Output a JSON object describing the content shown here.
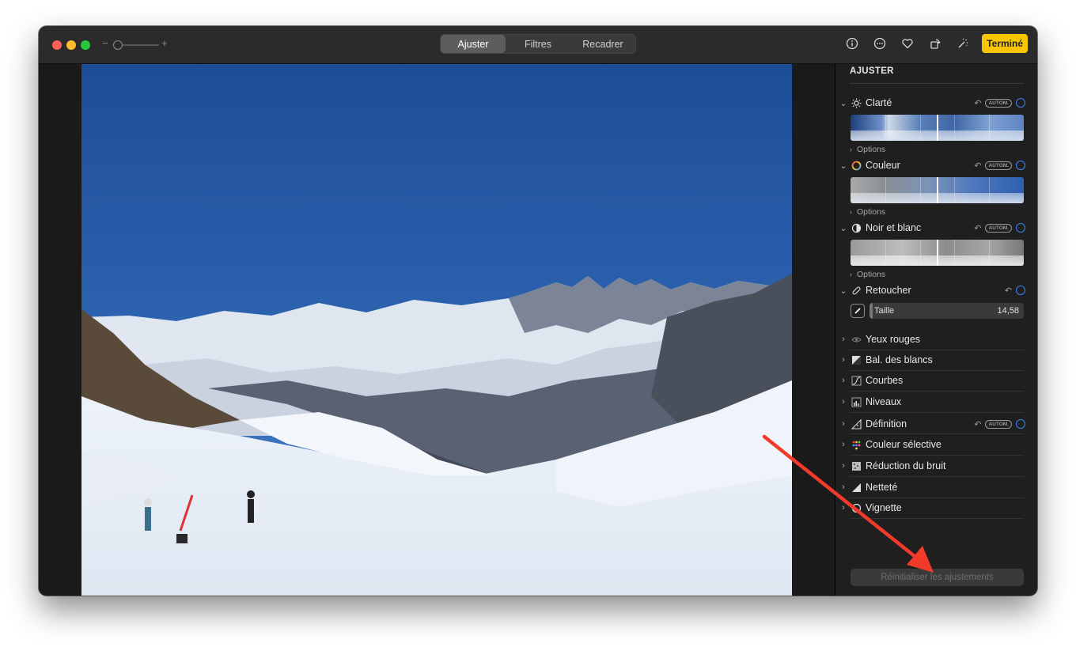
{
  "toolbar": {
    "zoom_minus": "−",
    "zoom_plus": "+",
    "tabs": [
      {
        "label": "Ajuster",
        "active": true
      },
      {
        "label": "Filtres",
        "active": false
      },
      {
        "label": "Recadrer",
        "active": false
      }
    ],
    "done_label": "Terminé",
    "icons": [
      "info-icon",
      "more-icon",
      "heart-icon",
      "rotate-icon",
      "magic-wand-icon"
    ]
  },
  "sidebar": {
    "title": "AJUSTER",
    "options_label": "Options",
    "sections": [
      {
        "label": "Clarté",
        "auto": "AUTOM.",
        "icon": "sun-icon",
        "expanded": true
      },
      {
        "label": "Couleur",
        "auto": "AUTOM.",
        "icon": "color-ring-icon",
        "expanded": true
      },
      {
        "label": "Noir et blanc",
        "auto": "AUTOM.",
        "icon": "half-circle-icon",
        "expanded": true
      },
      {
        "label": "Retoucher",
        "icon": "bandage-icon",
        "expanded": true
      }
    ],
    "retouch": {
      "size_label": "Taille",
      "size_value": "14,58"
    },
    "collapsed": [
      {
        "label": "Yeux rouges",
        "icon": "eye-icon"
      },
      {
        "label": "Bal. des blancs",
        "icon": "white-balance-icon"
      },
      {
        "label": "Courbes",
        "icon": "curves-icon"
      },
      {
        "label": "Niveaux",
        "icon": "levels-icon"
      },
      {
        "label": "Définition",
        "icon": "definition-icon",
        "auto": "AUTOM."
      },
      {
        "label": "Couleur sélective",
        "icon": "dots-icon"
      },
      {
        "label": "Réduction du bruit",
        "icon": "noise-icon"
      },
      {
        "label": "Netteté",
        "icon": "sharpen-icon"
      },
      {
        "label": "Vignette",
        "icon": "vignette-icon"
      }
    ],
    "reset_label": "Réinitialiser les ajustements"
  },
  "colors": {
    "accent": "#3b82f6",
    "done": "#f7c600",
    "annotation_arrow": "#f03a2a"
  }
}
